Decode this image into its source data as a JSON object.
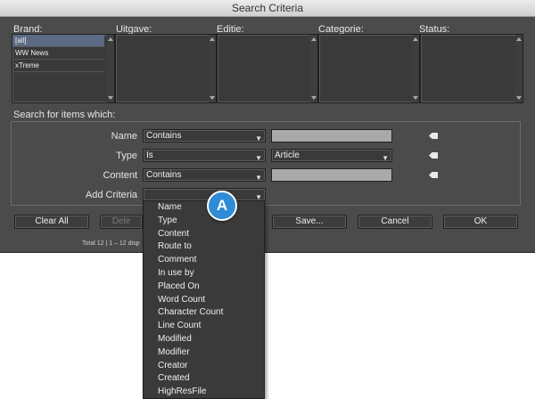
{
  "window": {
    "title": "Search Criteria"
  },
  "columns": [
    {
      "label": "Brand:",
      "items": [
        "[all]",
        "WW News",
        "xTreme"
      ]
    },
    {
      "label": "Uitgave:",
      "items": []
    },
    {
      "label": "Editie:",
      "items": []
    },
    {
      "label": "Categorie:",
      "items": []
    },
    {
      "label": "Status:",
      "items": []
    }
  ],
  "criteria": {
    "section_label": "Search for items which:",
    "rows": [
      {
        "label": "Name",
        "operator": "Contains",
        "value": ""
      },
      {
        "label": "Type",
        "operator": "Is",
        "value": "Article"
      },
      {
        "label": "Content",
        "operator": "Contains",
        "value": ""
      }
    ],
    "add_label": "Add Criteria",
    "add_value": ""
  },
  "buttons": {
    "clear_all": "Clear All",
    "delete": "Dele",
    "save": "Save...",
    "cancel": "Cancel",
    "ok": "OK"
  },
  "footer": {
    "status": "Total 12 | 1 – 12 disp"
  },
  "menu": {
    "items": [
      "Name",
      "Type",
      "Content",
      "Route to",
      "Comment",
      "In use by",
      "Placed On",
      "Word Count",
      "Character Count",
      "Line Count",
      "Modified",
      "Modifier",
      "Creator",
      "Created",
      "HighResFile"
    ]
  },
  "callout": {
    "label": "A"
  },
  "colors": {
    "window_bg": "#4b4b4b",
    "callout": "#2f8bd5",
    "selection": "#5d6a85"
  }
}
